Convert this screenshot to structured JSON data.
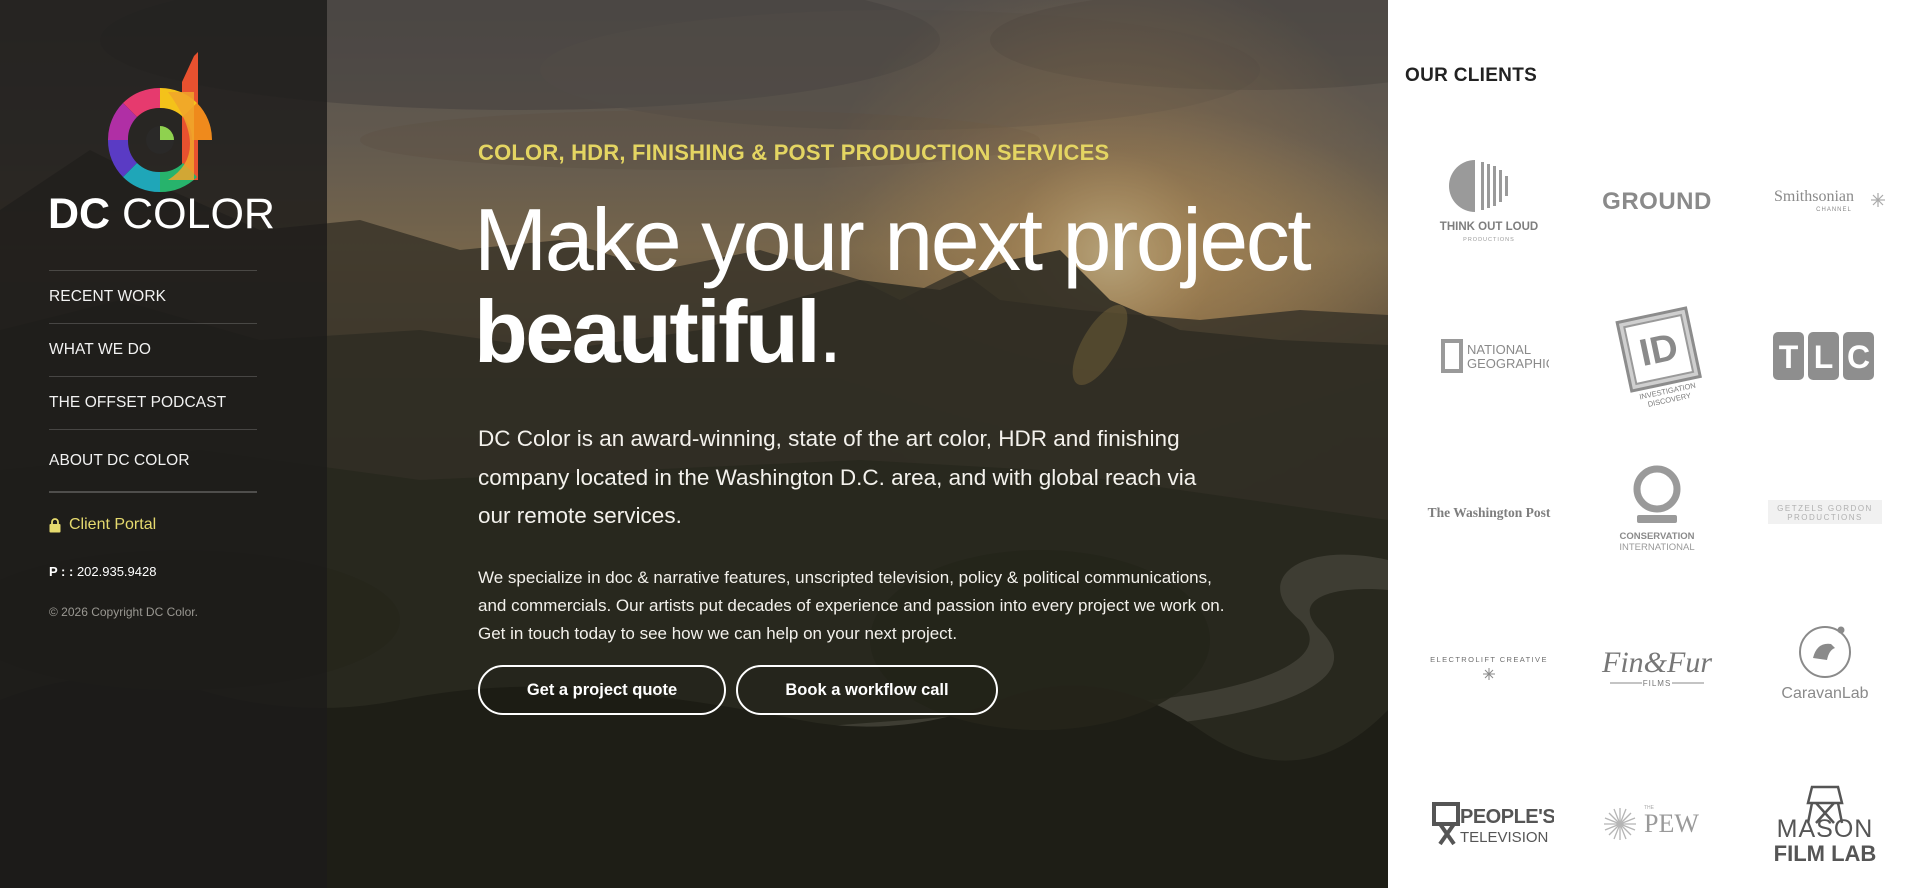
{
  "brand": {
    "name_bold": "DC",
    "name_light": " COLOR",
    "logo_icon": "dc-color-logo-icon"
  },
  "nav": {
    "items": [
      {
        "label": "RECENT WORK"
      },
      {
        "label": "WHAT WE DO"
      },
      {
        "label": "THE OFFSET PODCAST"
      },
      {
        "label": "ABOUT DC COLOR"
      }
    ]
  },
  "sidebar": {
    "portal_label": "Client Portal",
    "portal_icon": "lock-icon",
    "phone_prefix": "P : :",
    "phone_number": " 202.935.9428",
    "copyright": "© 2026 Copyright DC Color."
  },
  "hero": {
    "eyebrow": "COLOR, HDR, FINISHING & POST PRODUCTION SERVICES",
    "headline_line1": "Make your next project",
    "headline_bold": "beautiful",
    "headline_period": ".",
    "lead": "DC Color is an award-winning, state of the art color, HDR and finishing company located in the Washington D.C. area, and with global reach via our remote services.",
    "body": "We specialize in doc & narrative features, unscripted television, policy & political communications, and commercials. Our artists put decades of experience and passion into every project we work on. Get in touch today to see how we can help on your next project.",
    "cta_quote": "Get a project quote",
    "cta_call": "Book a workflow call"
  },
  "clients": {
    "title": "OUR CLIENTS",
    "logos": [
      {
        "name": "Think Out Loud Productions",
        "line1": "THINK OUT LOUD",
        "line2": "PRODUCTIONS"
      },
      {
        "name": "Ground",
        "line1": "GROUND"
      },
      {
        "name": "Smithsonian Channel",
        "line1": "Smithsonian",
        "line2": "CHANNEL"
      },
      {
        "name": "National Geographic",
        "line1": "NATIONAL",
        "line2": "GEOGRAPHIC"
      },
      {
        "name": "Investigation Discovery",
        "line1": "ID",
        "line2": "INVESTIGATION",
        "line3": "DISCOVERY"
      },
      {
        "name": "TLC",
        "line1": "T",
        "line2": "L",
        "line3": "C"
      },
      {
        "name": "The Washington Post",
        "line1": "The Washington Post"
      },
      {
        "name": "Conservation International",
        "line1": "CONSERVATION",
        "line2": "INTERNATIONAL"
      },
      {
        "name": "Getzels Gordon Productions",
        "line1": "GETZELS GORDON",
        "line2": "PRODUCTIONS"
      },
      {
        "name": "Electrolift Creative",
        "line1": "ELECTROLIFT CREATIVE"
      },
      {
        "name": "Fin & Fur Films",
        "line1": "Fin&Fur",
        "line2": "FILMS"
      },
      {
        "name": "CaravanLab",
        "line1": "CaravanLab"
      },
      {
        "name": "People's Television",
        "line1": "PEOPLE'S",
        "line2": "TELEVISION"
      },
      {
        "name": "The Pew Charitable Trusts",
        "line1": "PEW",
        "line2": "THE"
      },
      {
        "name": "Mason Film Lab",
        "line1": "MASON",
        "line2": "FILM LAB"
      }
    ]
  }
}
